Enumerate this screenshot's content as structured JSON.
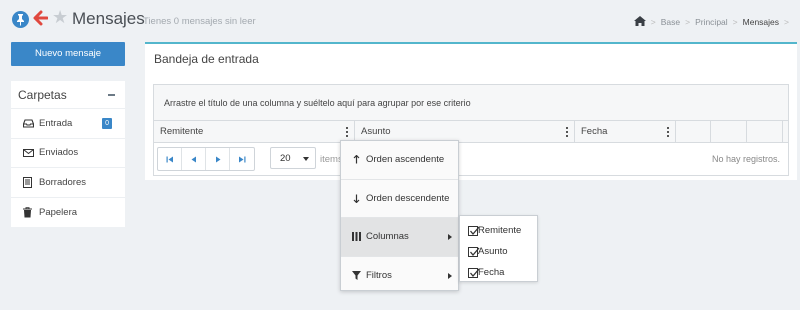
{
  "header": {
    "title": "Mensajes",
    "subtitle": "Tienes 0 mensajes sin leer",
    "breadcrumb": [
      "Base",
      "Principal",
      "Mensajes"
    ]
  },
  "sidebar": {
    "new_button": "Nuevo mensaje",
    "folders_title": "Carpetas",
    "items": [
      {
        "label": "Entrada",
        "icon": "inbox-icon",
        "badge": "0"
      },
      {
        "label": "Enviados",
        "icon": "envelope-icon"
      },
      {
        "label": "Borradores",
        "icon": "document-icon"
      },
      {
        "label": "Papelera",
        "icon": "trash-icon"
      }
    ]
  },
  "main": {
    "panel_title": "Bandeja de entrada",
    "group_hint": "Arrastre el título de una columna y suéltelo aquí para agrupar por ese criterio",
    "columns": [
      "Remitente",
      "Asunto",
      "Fecha"
    ],
    "page_size": "20",
    "items_label": "items",
    "no_records": "No hay registros."
  },
  "column_menu": {
    "sort_asc": "Orden ascendente",
    "sort_desc": "Orden descendente",
    "columns": "Columnas",
    "filters": "Filtros",
    "column_options": [
      {
        "label": "Remitente",
        "checked": true
      },
      {
        "label": "Asunto",
        "checked": true
      },
      {
        "label": "Fecha",
        "checked": true
      }
    ]
  },
  "colors": {
    "accent": "#3a87c8",
    "panel_border": "#53b6cc",
    "back_arrow": "#e0483e"
  }
}
